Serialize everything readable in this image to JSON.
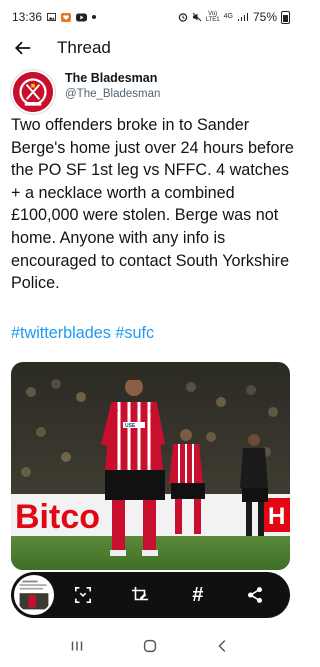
{
  "status_bar": {
    "time": "13:36",
    "network_top": "Vo)",
    "network_bottom": "LTE1",
    "network_gen": "4G",
    "battery": "75%"
  },
  "header": {
    "title": "Thread",
    "back_icon": "arrow-left-icon"
  },
  "tweet": {
    "author_name": "The Bladesman",
    "author_handle": "@The_Bladesman",
    "body": "Two offenders broke in to Sander Berge's home just over 24 hours before the PO SF 1st leg vs NFFC. 4 watches + a necklace worth a combined £100,000 were stolen. Berge was not home. Anyone with any info is encouraged to contact South Yorkshire Police.",
    "hashtags": [
      "#twitterblades",
      "#sufc"
    ],
    "media_boards": [
      "Bitco",
      "H"
    ],
    "shirt_sponsor": "USE"
  },
  "toolbar": {
    "icons": [
      "scan-icon",
      "crop-edit-icon",
      "hashtag-icon",
      "share-icon"
    ],
    "hashtag_glyph": "#"
  },
  "nav": {
    "icons": [
      "recent-apps-icon",
      "home-icon",
      "back-icon"
    ]
  },
  "colors": {
    "link": "#1d9bf0",
    "text": "#0f1419",
    "handle": "#536471",
    "toolbar_bg": "#101010"
  }
}
